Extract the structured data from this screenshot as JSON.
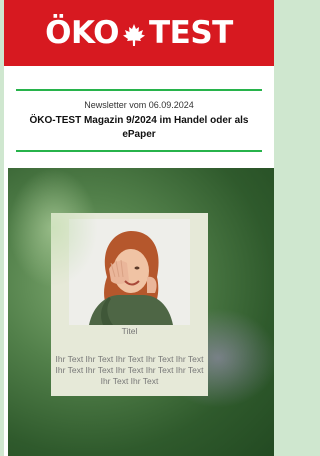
{
  "header": {
    "logo_text_left": "ÖKO",
    "logo_text_right": "TEST",
    "brand_color": "#d71920"
  },
  "newsletter": {
    "date_line": "Newsletter vom 06.09.2024",
    "headline": "ÖKO-TEST Magazin 9/2024 im Handel oder als ePaper",
    "rule_color": "#27b34b"
  },
  "hero": {
    "card": {
      "title": "Titel",
      "body": "Ihr Text Ihr Text Ihr Text Ihr Text Ihr Text Ihr Text Ihr Text Ihr Text Ihr Text Ihr Text Ihr Text Ihr Text"
    }
  },
  "icons": {
    "logo_mark": "maple-leaf-icon"
  }
}
